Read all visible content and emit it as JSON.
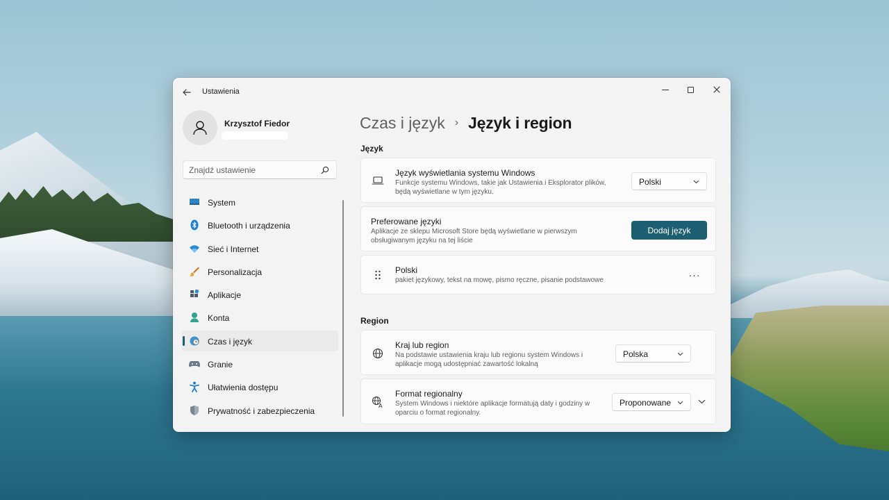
{
  "window": {
    "title": "Ustawienia",
    "back_icon": "arrow-left-icon",
    "controls": [
      "minimize-icon",
      "maximize-icon",
      "close-icon"
    ]
  },
  "user": {
    "name": "Krzysztof Fiedor",
    "avatar_icon": "person-icon"
  },
  "search": {
    "placeholder": "Znajdź ustawienie",
    "icon": "search-icon"
  },
  "sidebar": {
    "items": [
      {
        "label": "System",
        "icon": "monitor-icon",
        "selected": false
      },
      {
        "label": "Bluetooth i urządzenia",
        "icon": "bluetooth-icon",
        "selected": false
      },
      {
        "label": "Sieć i Internet",
        "icon": "wifi-icon",
        "selected": false
      },
      {
        "label": "Personalizacja",
        "icon": "brush-icon",
        "selected": false
      },
      {
        "label": "Aplikacje",
        "icon": "apps-icon",
        "selected": false
      },
      {
        "label": "Konta",
        "icon": "account-icon",
        "selected": false
      },
      {
        "label": "Czas i język",
        "icon": "clock-globe-icon",
        "selected": true
      },
      {
        "label": "Granie",
        "icon": "gamepad-icon",
        "selected": false
      },
      {
        "label": "Ułatwienia dostępu",
        "icon": "accessibility-icon",
        "selected": false
      },
      {
        "label": "Prywatność i zabezpieczenia",
        "icon": "shield-icon",
        "selected": false
      }
    ]
  },
  "breadcrumb": {
    "parent": "Czas i język",
    "separator": "›",
    "current": "Język i region"
  },
  "language_section": {
    "title": "Język",
    "display_language": {
      "title": "Język wyświetlania systemu Windows",
      "description_line1": "Funkcje systemu Windows, takie jak Ustawienia i Eksplorator plików,",
      "description_line2": "będą wyświetlane w tym języku.",
      "value": "Polski",
      "icon": "laptop-icon"
    },
    "preferred_languages": {
      "title": "Preferowane języki",
      "description_line1": "Aplikacje ze sklepu Microsoft Store będą wyświetlane w pierwszym",
      "description_line2": "obsługiwanym języku na tej liście",
      "button_label": "Dodaj język"
    },
    "language_entry": {
      "title": "Polski",
      "description": "pakiet językowy, tekst na mowę, pismo ręczne, pisanie podstawowe",
      "more_label": "···",
      "icon": "drag-handle-icon"
    }
  },
  "region_section": {
    "title": "Region",
    "country": {
      "title": "Kraj lub region",
      "description_line1": "Na podstawie ustawienia kraju lub regionu system Windows i",
      "description_line2": "aplikacje mogą udostępniać zawartość lokalną",
      "value": "Polska",
      "icon": "globe-icon"
    },
    "regional_format": {
      "title": "Format regionalny",
      "description_line1": "System Windows i niektóre aplikacje formatują daty i godziny w",
      "description_line2": "oparciu o format regionalny.",
      "value": "Proponowane",
      "icon": "regional-format-icon"
    }
  },
  "colors": {
    "accent": "#1d5f70",
    "window_bg": "#f3f3f3",
    "card_bg": "#fbfbfb"
  }
}
